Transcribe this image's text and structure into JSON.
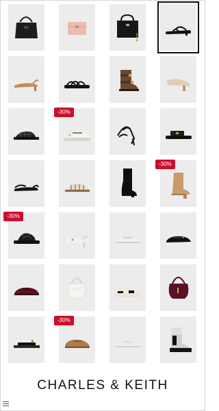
{
  "brand": {
    "name": "CHARLES & KEITH"
  },
  "selected_index": 3,
  "products": [
    {
      "icon": "black-tote-bag-icon",
      "badge": ""
    },
    {
      "icon": "pink-wallet-icon",
      "badge": ""
    },
    {
      "icon": "black-handbag-icon",
      "badge": ""
    },
    {
      "icon": "black-thong-sandal-icon",
      "badge": ""
    },
    {
      "icon": "tan-slingback-heel-icon",
      "badge": ""
    },
    {
      "icon": "black-strappy-flat-sandal-icon",
      "badge": ""
    },
    {
      "icon": "brown-suede-buckle-boot-icon",
      "badge": ""
    },
    {
      "icon": "beige-block-heel-pump-icon",
      "badge": ""
    },
    {
      "icon": "black-woven-sandal-icon",
      "badge": ""
    },
    {
      "icon": "white-chunky-mary-jane-icon",
      "badge": "-30%"
    },
    {
      "icon": "black-strappy-heel-sandal-icon",
      "badge": ""
    },
    {
      "icon": "black-slide-sandal-icon",
      "badge": ""
    },
    {
      "icon": "black-slingback-flat-icon",
      "badge": ""
    },
    {
      "icon": "beige-fisherman-sandal-icon",
      "badge": ""
    },
    {
      "icon": "black-knee-high-boot-icon",
      "badge": ""
    },
    {
      "icon": "tan-ankle-boot-icon",
      "badge": "-30%"
    },
    {
      "icon": "black-knotted-slide-icon",
      "badge": "-30%"
    },
    {
      "icon": "white-slingback-kitten-heel-icon",
      "badge": ""
    },
    {
      "icon": "white-mary-jane-flat-icon",
      "badge": ""
    },
    {
      "icon": "black-mary-jane-flat-icon",
      "badge": ""
    },
    {
      "icon": "burgundy-mary-jane-flat-icon",
      "badge": ""
    },
    {
      "icon": "white-hobo-bag-icon",
      "badge": ""
    },
    {
      "icon": "cream-platform-sandal-icon",
      "badge": ""
    },
    {
      "icon": "burgundy-shoulder-bag-icon",
      "badge": ""
    },
    {
      "icon": "black-white-buckle-sandal-icon",
      "badge": ""
    },
    {
      "icon": "tan-loafer-icon",
      "badge": "-30%"
    },
    {
      "icon": "white-ballet-flat-icon",
      "badge": ""
    },
    {
      "icon": "black-grey-chelsea-boot-icon",
      "badge": ""
    }
  ],
  "colors": {
    "tile_background": "#ececec",
    "badge_background": "#c8102e",
    "badge_text": "#ffffff",
    "brand_text": "#111111"
  }
}
